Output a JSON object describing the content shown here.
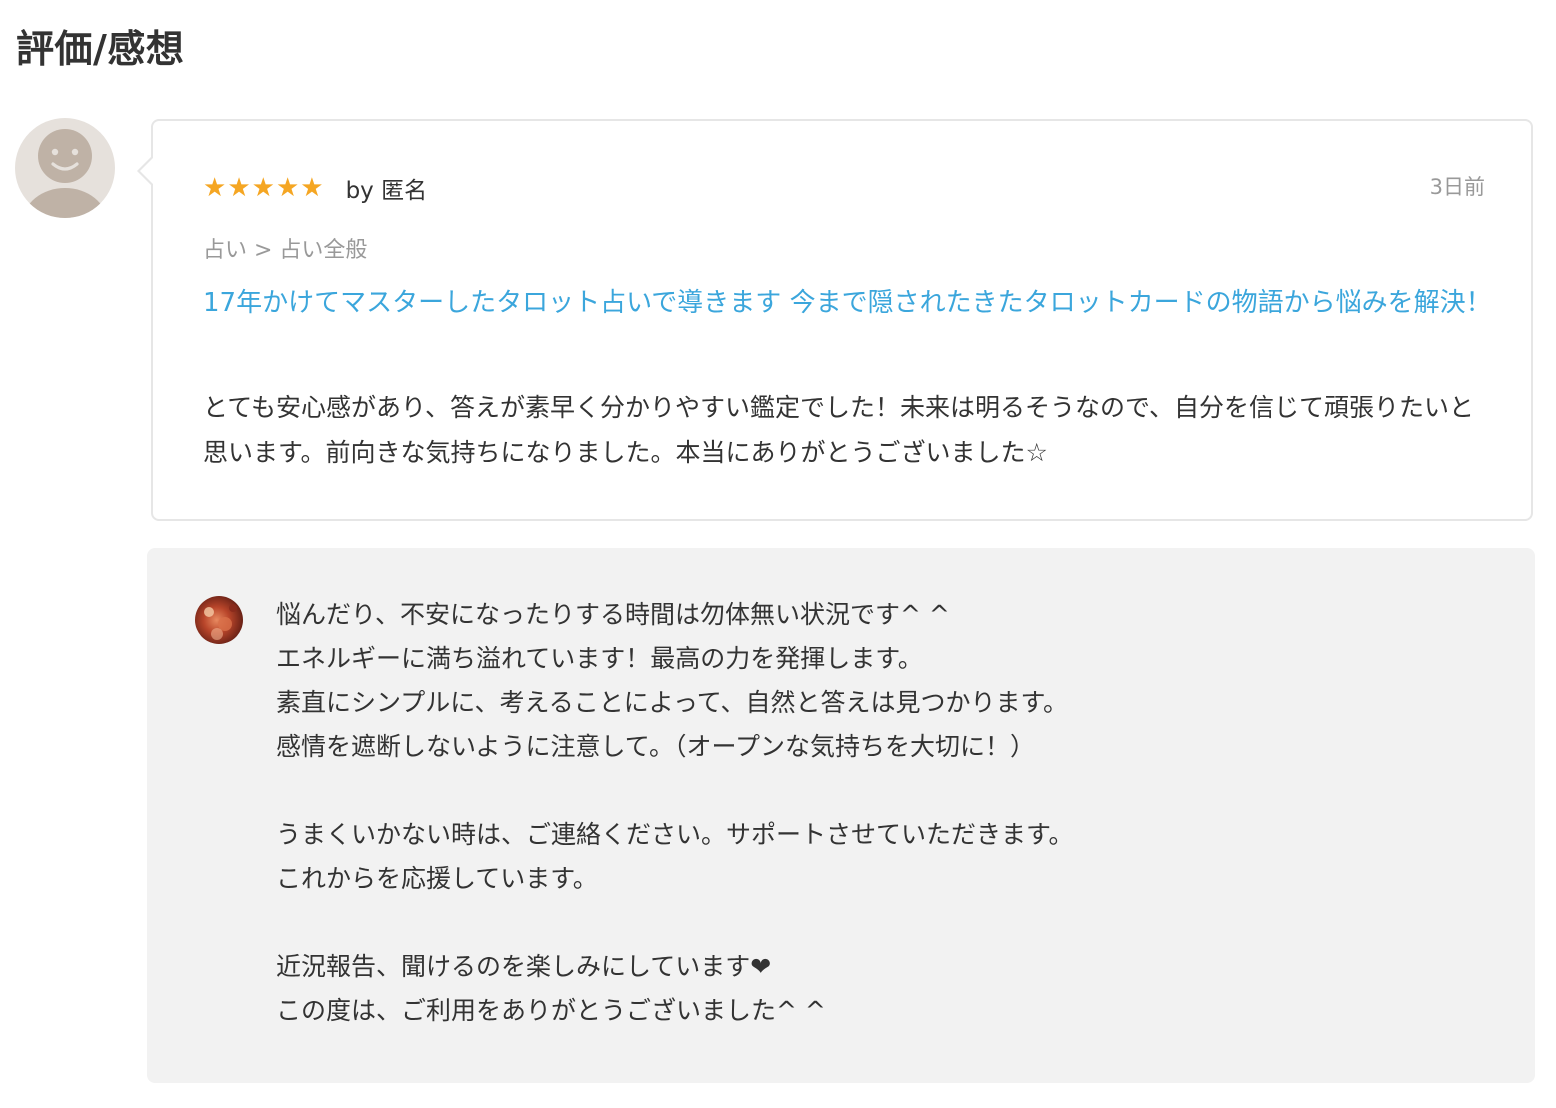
{
  "section": {
    "title": "評価/感想"
  },
  "review": {
    "rating": 5,
    "stars": [
      "★",
      "★",
      "★",
      "★",
      "★"
    ],
    "by_author": "by 匿名",
    "date": "3日前",
    "category": "占い > 占い全般",
    "service_title": "17年かけてマスターしたタロット占いで導きます 今まで隠されたきたタロットカードの物語から悩みを解決！",
    "text": "とても安心感があり、答えが素早く分かりやすい鑑定でした！未来は明るそうなので、自分を信じて頑張りたいと思います。前向きな気持ちになりました。本当にありがとうございました☆"
  },
  "reply": {
    "text": "悩んだり、不安になったりする時間は勿体無い状況です^ ^\nエネルギーに満ち溢れています！最高の力を発揮します。\n素直にシンプルに、考えることによって、自然と答えは見つかります。\n感情を遮断しないように注意して。（オープンな気持ちを大切に！）\n\nうまくいかない時は、ご連絡ください。サポートさせていただきます。\nこれからを応援しています。\n\n近況報告、聞けるのを楽しみにしています❤\nこの度は、ご利用をありがとうございました^ ^"
  },
  "colors": {
    "star": "#f5a623",
    "link": "#3ba6dc",
    "muted": "#999999",
    "text": "#333333",
    "reply_bg": "#f2f2f2",
    "card_border": "#e6e6e6",
    "avatar_bg": "#e6e1dc",
    "avatar_face": "#bfb2a6"
  },
  "icons": {
    "reviewer_avatar": "default-user-avatar-icon",
    "seller_avatar": "seller-photo-avatar"
  }
}
